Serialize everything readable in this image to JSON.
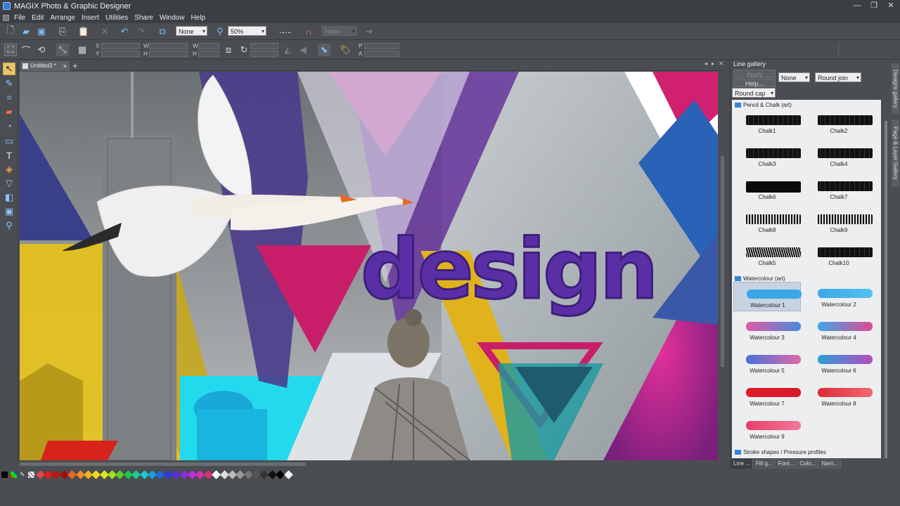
{
  "app": {
    "title": "MAGIX Photo & Graphic Designer"
  },
  "menu": [
    "File",
    "Edit",
    "Arrange",
    "Insert",
    "Utilities",
    "Share",
    "Window",
    "Help"
  ],
  "toolbar": {
    "quality_select": "None",
    "zoom_select": "50%",
    "disabled_select": "None",
    "coord_labels": [
      "X",
      "Y",
      "W",
      "H",
      "W",
      "H",
      "P",
      "A"
    ]
  },
  "document": {
    "tab_title": "Untitled3 *",
    "add_tab": "+",
    "close": "×"
  },
  "canvas": {
    "headline": "design"
  },
  "line_gallery": {
    "title": "Line gallery",
    "apply_label": "Apply",
    "help_label": "Help...",
    "arrow_select": "None",
    "join_select": "Round join",
    "cap_select": "Round cap",
    "categories": [
      {
        "name": "Pencil & Chalk (art)"
      },
      {
        "name": "Watercolour (art)"
      },
      {
        "name": "Stroke shapes / Pressure profiles"
      }
    ],
    "chalk_items": [
      "Chalk1",
      "Chalk2",
      "Chalk3",
      "Chalk4",
      "Chalk6",
      "Chalk7",
      "Chalk8",
      "Chalk9",
      "Chalk5",
      "Chalk10"
    ],
    "watercolour_items": [
      "Watercolour 1",
      "Watercolour 2",
      "Watercolour 3",
      "Watercolour 4",
      "Watercolour 5",
      "Watercolour 6",
      "Watercolour 7",
      "Watercolour 8",
      "Watercolour 9"
    ],
    "bottom_tabs": [
      "Line ...",
      "Fill g...",
      "Font...",
      "Colo...",
      "Nam..."
    ],
    "side_tabs": [
      "Designs gallery",
      "Page & Layer Gallery"
    ]
  },
  "colors": {
    "accent_blue": "#2f86d6",
    "selected_tool": "#e8c56a",
    "palette": [
      "#e04848",
      "#e81c1c",
      "#c81010",
      "#a80a0a",
      "#e8681c",
      "#f08c28",
      "#f0b020",
      "#f0d81c",
      "#d8e81c",
      "#a8e01c",
      "#58d028",
      "#1cc848",
      "#1cc88c",
      "#1cc8c8",
      "#1ca0e0",
      "#1c6ce0",
      "#2c3ce0",
      "#5c2ce0",
      "#8c2ce0",
      "#c02ce0",
      "#e02cb8",
      "#e02c78",
      "#ffffff",
      "#dddddd",
      "#bbbbbb",
      "#999999",
      "#777777",
      "#555555",
      "#333333",
      "#111111",
      "#000000",
      "#f0f0f0"
    ]
  }
}
